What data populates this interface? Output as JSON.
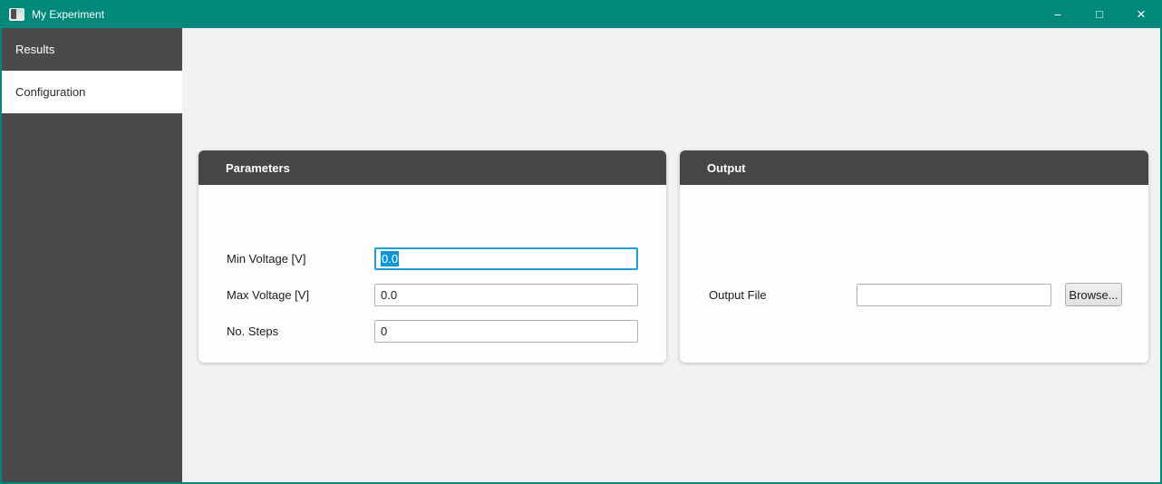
{
  "window": {
    "title": "My Experiment",
    "controls": {
      "minimize_glyph": "−",
      "maximize_glyph": "□",
      "close_glyph": "×"
    }
  },
  "sidebar": {
    "items": [
      {
        "label": "Results",
        "active": false
      },
      {
        "label": "Configuration",
        "active": true
      }
    ]
  },
  "parameters_panel": {
    "title": "Parameters",
    "fields": [
      {
        "label": "Min Voltage [V]",
        "value": "0.0",
        "focused": true
      },
      {
        "label": "Max Voltage [V]",
        "value": "0.0",
        "focused": false
      },
      {
        "label": "No. Steps",
        "value": "0",
        "focused": false
      }
    ]
  },
  "output_panel": {
    "title": "Output",
    "file_field": {
      "label": "Output File",
      "value": ""
    },
    "browse_button_label": "Browse..."
  },
  "colors": {
    "titlebar": "#00897b",
    "sidebar": "#4a4a4a",
    "panel_header": "#464646",
    "background": "#f2f2f2",
    "focus_border": "#1e9fd9",
    "selection": "#0d95d6"
  }
}
